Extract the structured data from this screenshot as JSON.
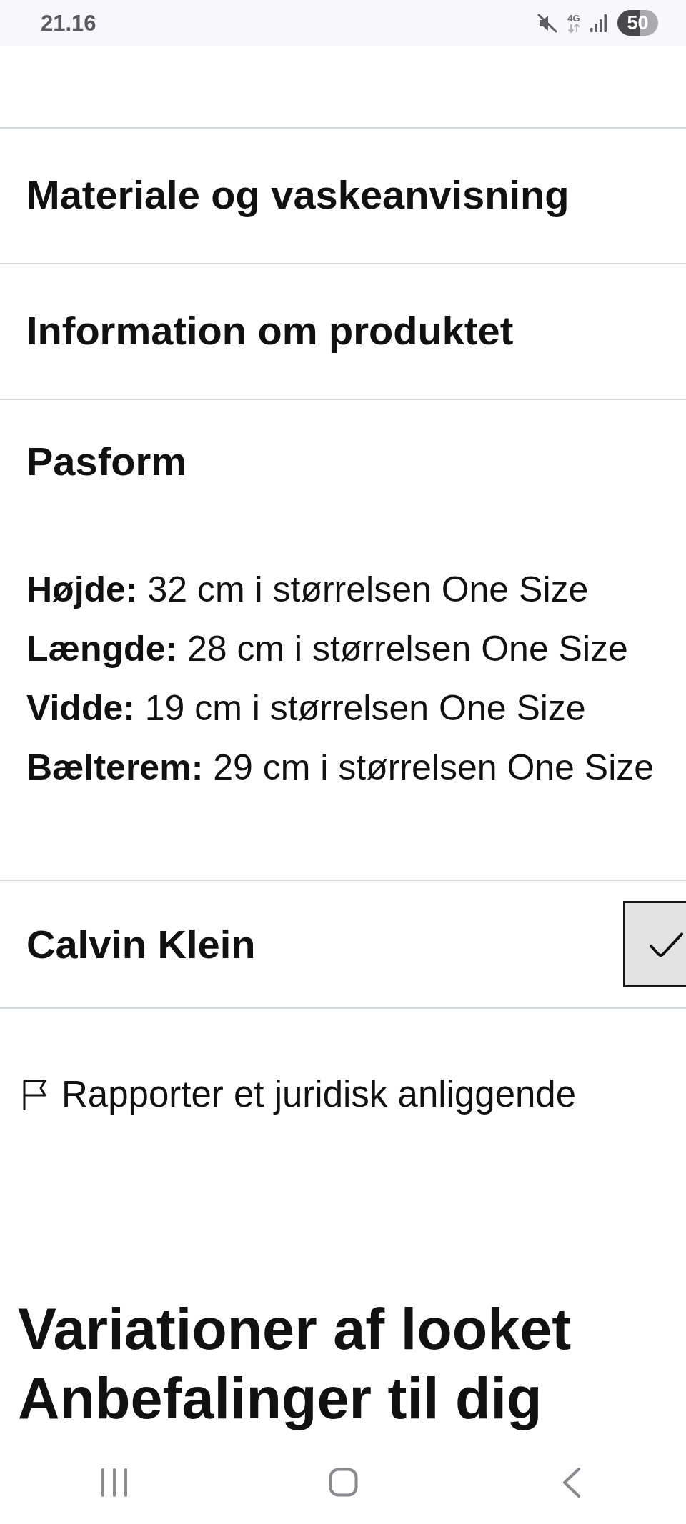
{
  "status_bar": {
    "time": "21.16",
    "network": "4G",
    "battery": "50"
  },
  "sections": [
    {
      "title": "Materiale og vaskeanvisning"
    },
    {
      "title": "Information om produktet"
    },
    {
      "title": "Pasform",
      "details": [
        "**Højde:** 32 cm i størrelsen One Size",
        "**Længde:** 28 cm i størrelsen One Size",
        "**Vidde:** 19 cm i størrelsen One Size",
        "**Bælterem:** 29 cm i størrelsen One Size"
      ]
    }
  ],
  "brand": {
    "name": "Calvin Klein",
    "checked": true
  },
  "report_link": "Rapporter et juridisk anliggende",
  "headings": [
    "Variationer af looket",
    "Anbefalinger til dig"
  ]
}
